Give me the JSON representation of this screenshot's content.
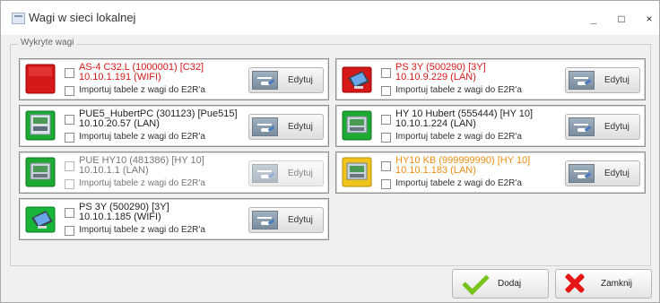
{
  "window": {
    "title": "Wagi w sieci lokalnej",
    "icons": {
      "app": "window-app-icon",
      "minimize": "minimize-icon",
      "maximize": "maximize-icon",
      "close": "close-icon"
    },
    "controls": {
      "minimize": "_",
      "maximize": "□",
      "close": "×"
    }
  },
  "group": {
    "label": "Wykryte wagi"
  },
  "devices": [
    {
      "icon": "red-scale-icon",
      "line1": "AS-4 C32.L (1000001) [C32]",
      "line2": "10.10.1.191 (WIFI)",
      "import": "Importuj tabele z wagi do E2R'a",
      "edit": "Edytuj",
      "tone": "red",
      "enabled": true
    },
    {
      "icon": "red-tablet-scale-icon",
      "line1": "PS 3Y (500290) [3Y]",
      "line2": "10.10.9.229 (LAN)",
      "import": "Importuj tabele z wagi do E2R'a",
      "edit": "Edytuj",
      "tone": "red",
      "enabled": true
    },
    {
      "icon": "green-scale-icon",
      "line1": "PUE5_HubertPC (301123) [Pue515]",
      "line2": "10.10.20.57 (LAN)",
      "import": "Importuj tabele z wagi do E2R'a",
      "edit": "Edytuj",
      "tone": "black",
      "enabled": true
    },
    {
      "icon": "green-scale-icon",
      "line1": "HY 10 Hubert (555444) [HY 10]",
      "line2": "10.10.1.224 (LAN)",
      "import": "Importuj tabele z wagi do E2R'a",
      "edit": "Edytuj",
      "tone": "black",
      "enabled": true
    },
    {
      "icon": "green-scale-icon",
      "line1": "PUE HY10 (481386) [HY 10]",
      "line2": "10.10.1.1 (LAN)",
      "import": "Importuj tabele z wagi do E2R'a",
      "edit": "Edytuj",
      "tone": "gray",
      "enabled": false
    },
    {
      "icon": "yellow-scale-icon",
      "line1": "HY10 KB (999999990) [HY 10]",
      "line2": "10.10.1.183 (LAN)",
      "import": "Importuj tabele z wagi do E2R'a",
      "edit": "Edytuj",
      "tone": "orange",
      "enabled": true
    },
    {
      "icon": "green-tablet-scale-icon",
      "line1": "PS 3Y (500290) [3Y]",
      "line2": "10.10.1.185 (WIFI)",
      "import": "Importuj tabele z wagi do E2R'a",
      "edit": "Edytuj",
      "tone": "black",
      "enabled": true
    }
  ],
  "buttons": {
    "add": "Dodaj",
    "close": "Zamknij"
  },
  "colors": {
    "red": "#d41717",
    "orange": "#ef8d12",
    "green": "#79c41b"
  }
}
